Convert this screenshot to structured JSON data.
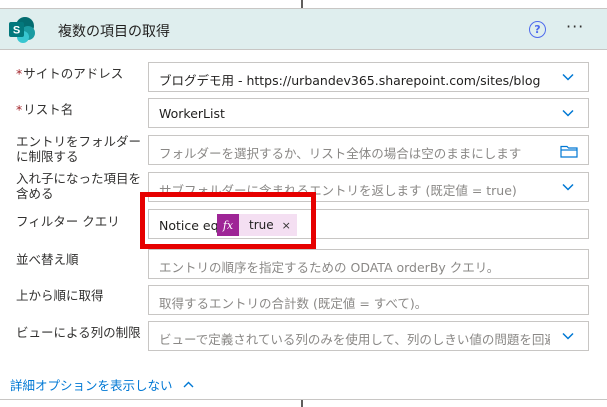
{
  "header": {
    "title": "複数の項目の取得",
    "help_glyph": "?",
    "more_glyph": "···",
    "logo_letter": "S",
    "brand_color": "#036c70"
  },
  "fields": {
    "site": {
      "label": "サイトのアドレス",
      "required": "*",
      "value": "ブログデモ用 - https://urbandev365.sharepoint.com/sites/blog"
    },
    "list": {
      "label": "リスト名",
      "required": "*",
      "value": "WorkerList"
    },
    "folder": {
      "label_line1": "エントリをフォルダー",
      "label_line2": "に制限する",
      "placeholder": "フォルダーを選択するか、リスト全体の場合は空のままにします"
    },
    "nested": {
      "label_line1": "入れ子になった項目を",
      "label_line2": "含める",
      "placeholder": "サブフォルダーに含まれるエントリを返します (既定値 = true)"
    },
    "filter": {
      "label": "フィルター クエリ",
      "text": "Notice eq",
      "token_fx": "fx",
      "token_value": "true",
      "token_close": "×"
    },
    "order": {
      "label": "並べ替え順",
      "placeholder": "エントリの順序を指定するための ODATA orderBy クエリ。"
    },
    "top": {
      "label": "上から順に取得",
      "placeholder": "取得するエントリの合計数 (既定値 = すべて)。"
    },
    "view": {
      "label": "ビューによる列の制限",
      "placeholder": "ビューで定義されている列のみを使用して、列のしきい値の問題を回避"
    }
  },
  "advanced": {
    "label": "詳細オプションを表示しない"
  },
  "colors": {
    "accent": "#0078d4",
    "highlight": "#e60000",
    "token": "#9e2596"
  }
}
